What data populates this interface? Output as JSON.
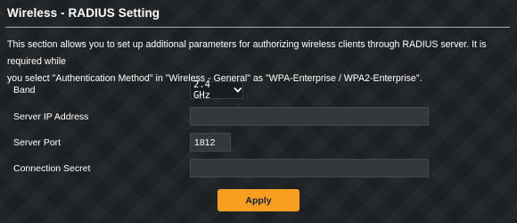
{
  "page": {
    "title": "Wireless - RADIUS Setting",
    "description_line1": "This section allows you to set up additional parameters for authorizing wireless clients through RADIUS server. It is required while",
    "description_line2": "you select \"Authentication Method\" in \"Wireless - General\" as \"WPA-Enterprise / WPA2-Enterprise\"."
  },
  "form": {
    "band": {
      "label": "Band",
      "selected": "2.4 GHz"
    },
    "server_ip": {
      "label": "Server IP Address",
      "value": ""
    },
    "server_port": {
      "label": "Server Port",
      "value": "1812"
    },
    "connection_secret": {
      "label": "Connection Secret",
      "value": ""
    }
  },
  "actions": {
    "apply_label": "Apply"
  },
  "colors": {
    "accent": "#f7a020",
    "background": "#1f2326",
    "input_bg": "#34383c"
  },
  "icons": {
    "band_dropdown": "chevron-down-icon"
  }
}
